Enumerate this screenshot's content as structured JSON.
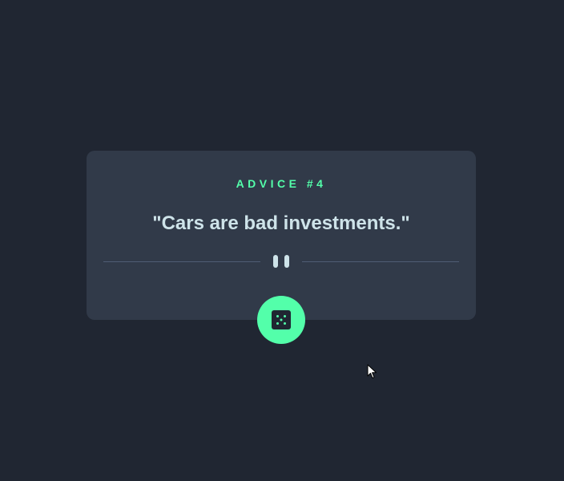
{
  "advice": {
    "id_label": "ADVICE #4",
    "quote": "\"Cars are bad investments.\""
  },
  "icons": {
    "divider": "pause-icon",
    "button": "dice-icon",
    "cursor": "mouse-pointer-icon"
  },
  "colors": {
    "background": "#202632",
    "card": "#313a49",
    "accent": "#53ffaa",
    "text": "#cee3e9",
    "divider": "#4f5d74"
  }
}
